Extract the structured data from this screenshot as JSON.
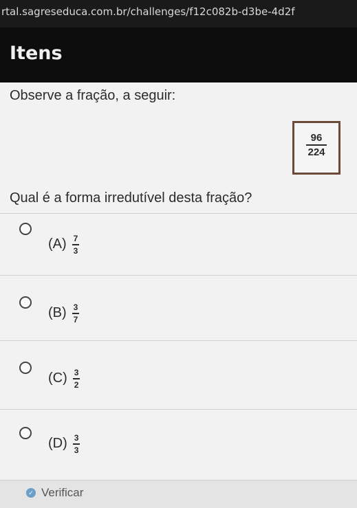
{
  "browser": {
    "url": "rtal.sagreseduca.com.br/challenges/f12c082b-d3be-4d2f"
  },
  "header": {
    "title": "Itens"
  },
  "question": {
    "prompt": "Observe a fração, a seguir:",
    "fraction": {
      "numerator": "96",
      "denominator": "224"
    },
    "text": "Qual é a forma irredutível desta fração?"
  },
  "options": [
    {
      "letter": "(A)",
      "numerator": "7",
      "denominator": "3"
    },
    {
      "letter": "(B)",
      "numerator": "3",
      "denominator": "7"
    },
    {
      "letter": "(C)",
      "numerator": "3",
      "denominator": "2"
    },
    {
      "letter": "(D)",
      "numerator": "3",
      "denominator": "3"
    }
  ],
  "footer": {
    "verify_label": "Verificar"
  },
  "colors": {
    "accent": "#6aa0c8",
    "box_border": "#6b4a3a"
  }
}
